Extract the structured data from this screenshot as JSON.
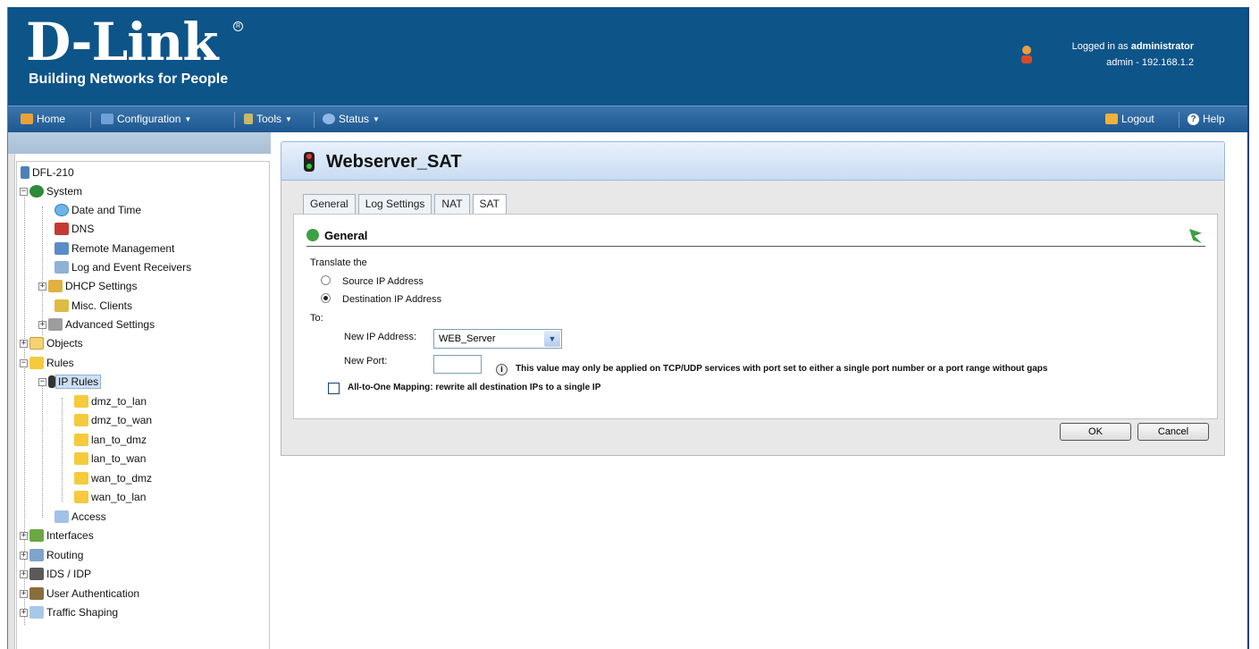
{
  "header": {
    "logo_text": "D-Link",
    "logo_reg": "R",
    "tagline": "Building Networks for People",
    "login_prefix": "Logged in as ",
    "login_user": "administrator",
    "login_detail": "admin - 192.168.1.2"
  },
  "menu": {
    "home": "Home",
    "configuration": "Configuration",
    "tools": "Tools",
    "status": "Status",
    "logout": "Logout",
    "help": "Help"
  },
  "tree": {
    "device": "DFL-210",
    "system": "System",
    "date_time": "Date and Time",
    "dns": "DNS",
    "remote_mgmt": "Remote Management",
    "log_receivers": "Log and Event Receivers",
    "dhcp": "DHCP Settings",
    "misc_clients": "Misc. Clients",
    "advanced": "Advanced Settings",
    "objects": "Objects",
    "rules": "Rules",
    "ip_rules": "IP Rules",
    "ip_rule_items": [
      "dmz_to_lan",
      "dmz_to_wan",
      "lan_to_dmz",
      "lan_to_wan",
      "wan_to_dmz",
      "wan_to_lan"
    ],
    "access": "Access",
    "interfaces": "Interfaces",
    "routing": "Routing",
    "ids_idp": "IDS / IDP",
    "user_auth": "User Authentication",
    "traffic_shaping": "Traffic Shaping"
  },
  "panel": {
    "title": "Webserver_SAT",
    "tabs": [
      "General",
      "Log Settings",
      "NAT",
      "SAT"
    ],
    "active_tab": "SAT",
    "section_title": "General"
  },
  "form": {
    "translate_label": "Translate the",
    "source_ip_label": "Source IP Address",
    "dest_ip_label": "Destination IP Address",
    "selected_translate": "Destination IP Address",
    "to_label": "To:",
    "new_ip_label": "New IP Address:",
    "new_ip_value": "WEB_Server",
    "new_port_label": "New Port:",
    "new_port_value": "",
    "port_hint": "This value may only be applied on TCP/UDP services with port set to either a single port number or a port range without gaps",
    "all_to_one_label": "All-to-One Mapping: rewrite all destination IPs to a single IP",
    "all_to_one_checked": false
  },
  "buttons": {
    "ok": "OK",
    "cancel": "Cancel"
  },
  "colors": {
    "header_bg": "#0d5489",
    "menubar": "#2a66a0",
    "panel_title_bg": "#d6e6f7"
  }
}
